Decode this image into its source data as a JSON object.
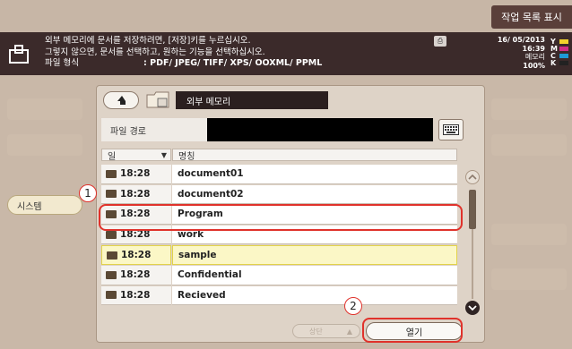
{
  "header": {
    "job_list_label": "작업 목록 표시"
  },
  "message": {
    "line1": "외부 메모리에 문서를 저장하려면, [저장]키를 누르십시오.",
    "line2": "그렇지 않으면, 문서를 선택하고, 원하는 기능을 선택하십시오.",
    "file_format_label": "파일 형식",
    "file_format_value": ": PDF/ JPEG/ TIFF/ XPS/ OOXML/ PPML"
  },
  "status": {
    "date": "16/ 05/2013",
    "time": "16:39",
    "memory_label": "메모리",
    "memory_value": "100%",
    "toner": [
      {
        "key": "Y",
        "color": "#f2d22b"
      },
      {
        "key": "M",
        "color": "#d12e86"
      },
      {
        "key": "C",
        "color": "#1e9ad6"
      },
      {
        "key": "K",
        "color": "#222222"
      }
    ]
  },
  "sidebar": {
    "system_label": "시스템"
  },
  "panel": {
    "folder_title": "외부 메모리",
    "path_label": "파일 경로",
    "path_value": "",
    "header_date": "일",
    "header_name": "명칭",
    "files": [
      {
        "time": "18:28",
        "name": "document01"
      },
      {
        "time": "18:28",
        "name": "document02"
      },
      {
        "time": "18:28",
        "name": "Program"
      },
      {
        "time": "18:28",
        "name": "work"
      },
      {
        "time": "18:28",
        "name": "sample"
      },
      {
        "time": "18:28",
        "name": "Confidential"
      },
      {
        "time": "18:28",
        "name": "Recieved"
      }
    ],
    "upper_label": "상단",
    "open_label": "열기"
  },
  "annotations": {
    "step1": "1",
    "step2": "2",
    "color": "#e0322b"
  }
}
